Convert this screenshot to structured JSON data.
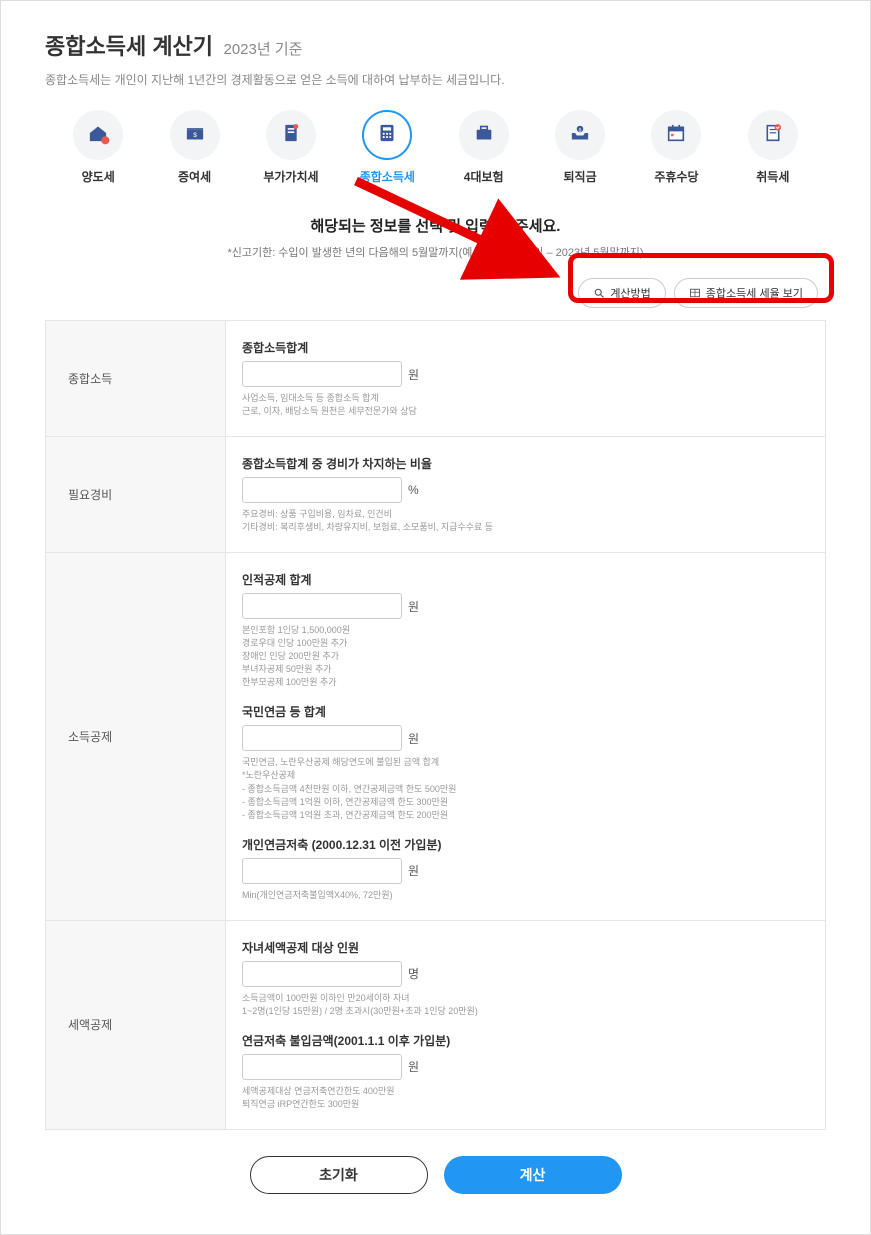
{
  "header": {
    "title": "종합소득세 계산기",
    "subtitle": "2023년 기준",
    "description": "종합소득세는 개인이 지난해 1년간의 경제활동으로 얻은 소득에 대하여 납부하는 세금입니다."
  },
  "tabs": [
    {
      "label": "양도세"
    },
    {
      "label": "증여세"
    },
    {
      "label": "부가가치세"
    },
    {
      "label": "종합소득세",
      "selected": true
    },
    {
      "label": "4대보험"
    },
    {
      "label": "퇴직금"
    },
    {
      "label": "주휴수당"
    },
    {
      "label": "취득세"
    }
  ],
  "instruction": "해당되는 정보를 선택 및 입력 해 주세요.",
  "note": "*신고기한: 수입이 발생한 년의 다음해의 5월말까지(예시 2022년 수입 – 2023년 5월말까지)",
  "help_buttons": {
    "method": "계산방법",
    "rates": "종합소득세 세율 보기"
  },
  "form": {
    "income": {
      "row_label": "종합소득",
      "total": {
        "label": "종합소득합계",
        "unit": "원",
        "hint": "사업소득, 임대소득 등 종합소득 합계\n근로, 이자, 배당소득 원천은 세무전문가와 상담"
      }
    },
    "expense": {
      "row_label": "필요경비",
      "ratio": {
        "label": "종합소득합계 중 경비가 차지하는 비율",
        "unit": "%",
        "hint": "주요경비: 상품 구입비용, 임차료, 인건비\n기타경비: 복리후생비, 차량유지비, 보험료, 소모품비, 지급수수료 등"
      }
    },
    "deduction": {
      "row_label": "소득공제",
      "personal": {
        "label": "인적공제 합계",
        "unit": "원",
        "hint": "본인포함 1인당 1,500,000원\n경로우대 인당 100만원 추가\n장애인 인당 200만원 추가\n부녀자공제 50만원 추가\n한부모공제 100만원 추가"
      },
      "pension": {
        "label": "국민연금 등 합계",
        "unit": "원",
        "hint": "국민연금, 노란우산공제 해당연도에 불입된 금액 합계\n*노란우산공제\n- 종합소득금액 4천만원 이하, 연간공제금액 한도 500만원\n- 종합소득금액 1억원 이하, 연간공제금액 한도 300만원\n- 종합소득금액 1억원 초과, 연간공제금액 한도 200만원"
      },
      "private_pension": {
        "label": "개인연금저축 (2000.12.31 이전 가입분)",
        "unit": "원",
        "hint": "Min(개인연금저축불입액X40%, 72만원)"
      }
    },
    "tax_deduction": {
      "row_label": "세액공제",
      "children": {
        "label": "자녀세액공제 대상 인원",
        "unit": "명",
        "hint": "소득금액이 100만원 이하인 만20세이하 자녀\n1~2명(1인당 15만원) / 2명 초과시(30만원+초과 1인당 20만원)"
      },
      "pension_save": {
        "label": "연금저축 불입금액(2001.1.1 이후 가입분)",
        "unit": "원",
        "hint": "세액공제대상 연금저축연간한도 400만원\n퇴직연금 iRP연간한도 300만원"
      }
    }
  },
  "actions": {
    "reset": "초기화",
    "submit": "계산"
  }
}
